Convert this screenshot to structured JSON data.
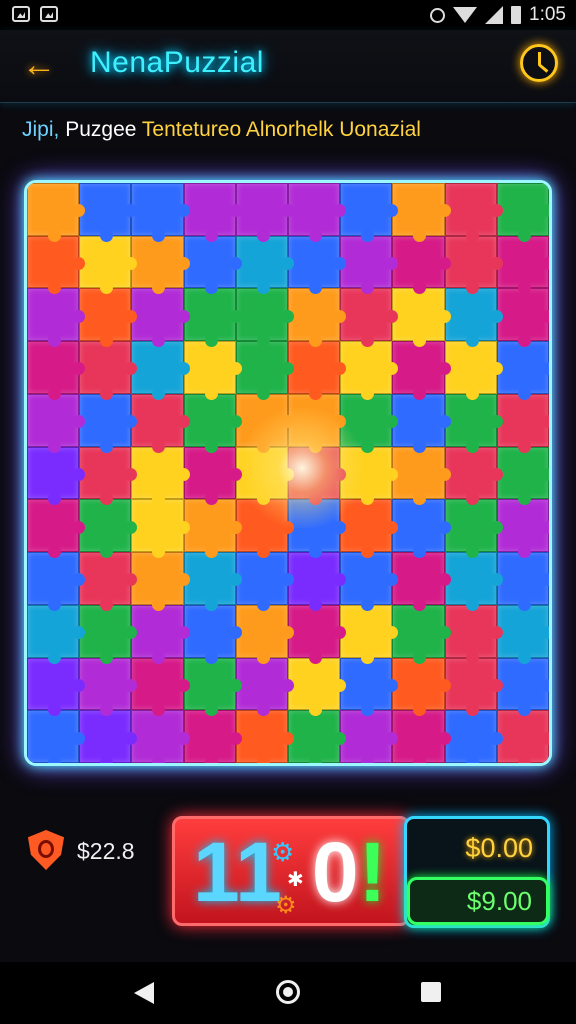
{
  "status_bar": {
    "time": "1:05",
    "icons": [
      "image-icon",
      "gallery-icon",
      "alarm-icon",
      "wifi-icon",
      "cell-signal-icon",
      "battery-icon"
    ]
  },
  "app_bar": {
    "title": "NenaPuzzial",
    "back_icon": "back-arrow-icon",
    "action_icon": "clock-icon"
  },
  "subtitle": {
    "part1": "Jipi,",
    "part2": "Puzgee",
    "part3": "Tentetureo Alnorhelk Uonazial"
  },
  "board": {
    "columns": 10,
    "rows": 11,
    "palette": [
      "#ff9b1c",
      "#2f6bff",
      "#1fb34a",
      "#b12bd6",
      "#e8365a",
      "#ffd21f",
      "#15a4d8",
      "#7a2cff",
      "#ff5a1f",
      "#d61a88"
    ],
    "colors": [
      [
        0,
        1,
        1,
        3,
        3,
        3,
        1,
        0,
        4,
        2
      ],
      [
        8,
        5,
        0,
        1,
        6,
        1,
        3,
        9,
        4,
        9
      ],
      [
        3,
        8,
        3,
        2,
        2,
        0,
        4,
        5,
        6,
        9
      ],
      [
        9,
        4,
        6,
        5,
        2,
        8,
        5,
        9,
        5,
        1
      ],
      [
        3,
        1,
        4,
        2,
        0,
        0,
        2,
        1,
        2,
        4
      ],
      [
        7,
        4,
        5,
        9,
        5,
        4,
        5,
        0,
        4,
        2
      ],
      [
        9,
        2,
        5,
        0,
        8,
        1,
        8,
        1,
        2,
        3
      ],
      [
        1,
        4,
        0,
        6,
        1,
        7,
        1,
        9,
        6,
        1
      ],
      [
        6,
        2,
        3,
        1,
        0,
        9,
        5,
        2,
        4,
        6
      ],
      [
        7,
        3,
        9,
        2,
        3,
        5,
        1,
        8,
        4,
        1
      ],
      [
        1,
        7,
        3,
        9,
        8,
        2,
        3,
        9,
        1,
        4
      ]
    ]
  },
  "footer": {
    "coins": "$22.8",
    "score": {
      "d1": "11",
      "d2": "0",
      "d3": "!"
    },
    "money_top": "$0.00",
    "money_bottom": "$9.00",
    "shield_icon": "shield-icon",
    "gear_icon": "gear-icon"
  },
  "nav": {
    "back_icon": "nav-back-icon",
    "home_icon": "nav-home-icon",
    "recent_icon": "nav-recent-icon"
  }
}
